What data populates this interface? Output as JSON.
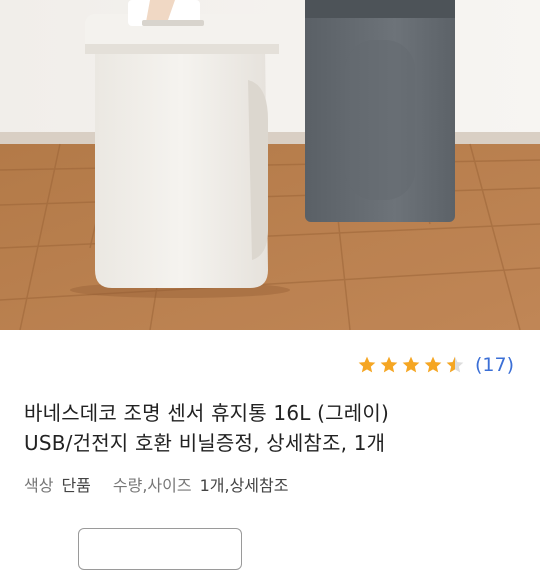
{
  "product": {
    "rating": {
      "stars": 4.5,
      "max_stars": 5,
      "count_text": "(17)"
    },
    "title_lines": [
      "바네스데코 조명 센서 휴지통 16L (그레이)",
      "USB/건전지 호환 비닐증정, 상세참조, 1개"
    ],
    "options": {
      "color_label": "색상",
      "color_value": "단품",
      "size_label": "수량,사이즈",
      "size_value": "1개,상세참조"
    }
  },
  "colors": {
    "star": "#f5a623",
    "rating_count": "#3b6fd6",
    "title": "#222222"
  },
  "icons": {
    "star": "star-icon",
    "photo": "product-photo"
  }
}
